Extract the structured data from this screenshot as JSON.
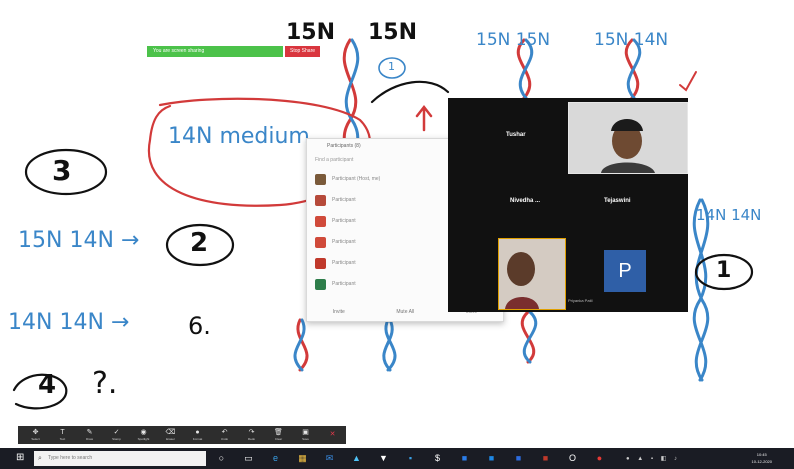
{
  "board": {
    "labels": {
      "n15_top": "15N",
      "n15_top2": "15N",
      "circle_one": "1",
      "n14_medium": "14N medium",
      "circle_three": "3",
      "n15_n14": "15N 14N →",
      "circle_two": "2",
      "n14_n14": "14N 14N →",
      "six": "6.",
      "circle_four": "4",
      "question": "?.",
      "right_pair1": "15N 15N",
      "right_pair2": "15N 14N",
      "right_ln": "14N 14N",
      "circle_one_right": "1"
    }
  },
  "share_banner": {
    "text": "You are screen sharing",
    "stop_label": "Stop Share"
  },
  "participants_panel": {
    "title": "Participants (8)",
    "search_placeholder": "Find a participant",
    "rows": [
      {
        "initial": "",
        "name": "Participant (Host, me)",
        "color": "#7a5a3a"
      },
      {
        "initial": "",
        "name": "Participant",
        "color": "#b64a3a"
      },
      {
        "initial": "",
        "name": "Participant",
        "color": "#d04a3a"
      },
      {
        "initial": "",
        "name": "Participant",
        "color": "#d04a3a"
      },
      {
        "initial": "",
        "name": "Participant",
        "color": "#c0392b"
      },
      {
        "initial": "",
        "name": "Participant",
        "color": "#2e7d4a"
      }
    ],
    "footer": [
      "Invite",
      "Mute All",
      "More"
    ]
  },
  "video_panel": {
    "tiles": [
      "Tushar",
      "Tejaswini",
      "Nivedha ..."
    ],
    "presenter_initial": "P",
    "presenter_label": "Priyanka Patil"
  },
  "toolbar": {
    "buttons": [
      {
        "icon": "✥",
        "label": "Select"
      },
      {
        "icon": "T",
        "label": "Text"
      },
      {
        "icon": "✎",
        "label": "Draw"
      },
      {
        "icon": "✓",
        "label": "Stamp"
      },
      {
        "icon": "◉",
        "label": "Spotlight"
      },
      {
        "icon": "⌫",
        "label": "Eraser"
      },
      {
        "icon": "●",
        "label": "Format"
      },
      {
        "icon": "↶",
        "label": "Undo"
      },
      {
        "icon": "↷",
        "label": "Redo"
      },
      {
        "icon": "🗑",
        "label": "Clear"
      },
      {
        "icon": "▣",
        "label": "Save"
      },
      {
        "icon": "✕",
        "label": ""
      }
    ]
  },
  "taskbar": {
    "search_placeholder": "Type here to search",
    "apps": [
      {
        "icon": "○",
        "color": "#ffffff"
      },
      {
        "icon": "▭",
        "color": "#ffffff"
      },
      {
        "icon": "e",
        "color": "#3aa0e6"
      },
      {
        "icon": "▦",
        "color": "#f5c344"
      },
      {
        "icon": "✉",
        "color": "#3a8ee6"
      },
      {
        "icon": "▲",
        "color": "#4fc3f7"
      },
      {
        "icon": "▼",
        "color": "#ffffff"
      },
      {
        "icon": "▪",
        "color": "#3aa0e6"
      },
      {
        "icon": "$",
        "color": "#ffffff"
      },
      {
        "icon": "■",
        "color": "#2b7de9"
      },
      {
        "icon": "■",
        "color": "#1e88e5"
      },
      {
        "icon": "■",
        "color": "#2d6cdf"
      },
      {
        "icon": "■",
        "color": "#c0392b"
      },
      {
        "icon": "O",
        "color": "#ffffff"
      },
      {
        "icon": "●",
        "color": "#e53935"
      }
    ],
    "clock_time": "10:45",
    "clock_date": "10-12-2020"
  }
}
